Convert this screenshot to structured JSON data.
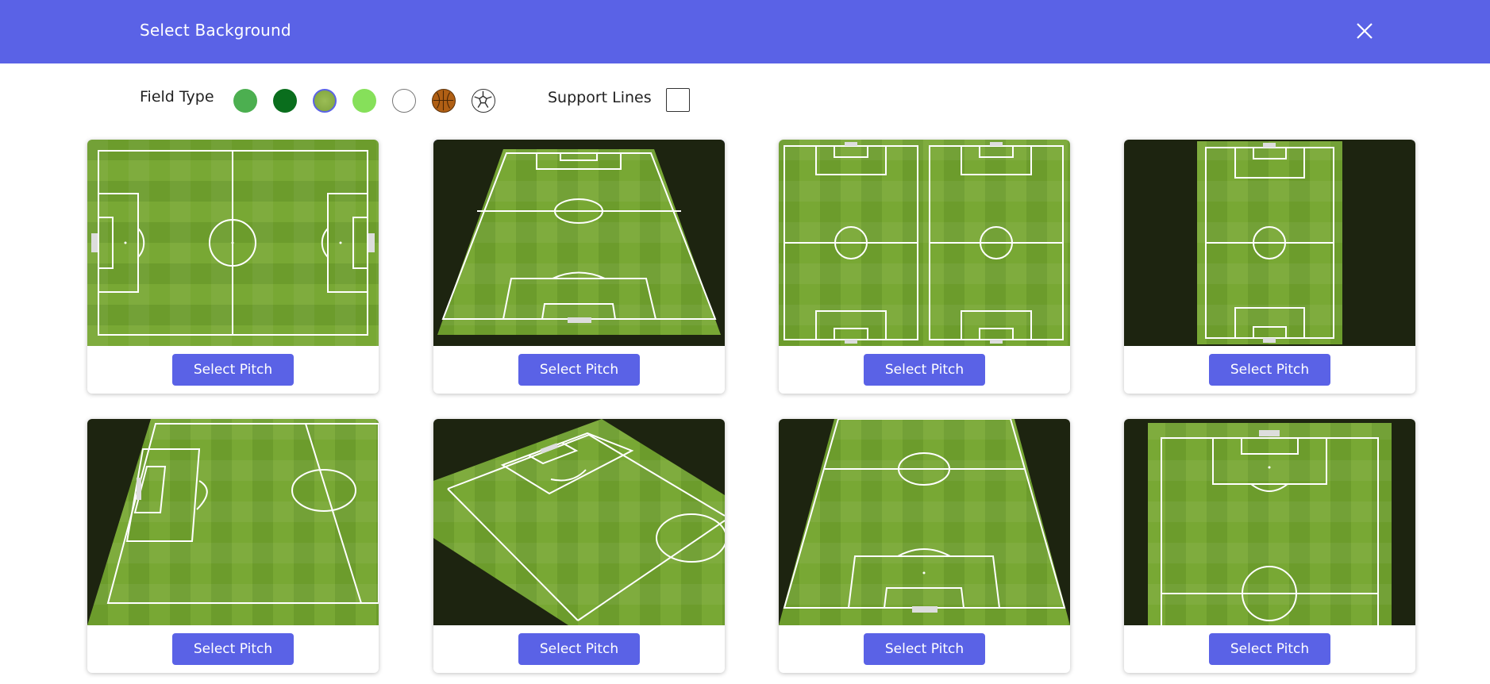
{
  "header": {
    "title": "Select Background",
    "close_icon": "close-icon"
  },
  "toolbar": {
    "field_type_label": "Field Type",
    "field_types": [
      {
        "name": "grass-green",
        "color": "#4caf50"
      },
      {
        "name": "dark-green",
        "color": "#0a6e1d"
      },
      {
        "name": "textured-grass",
        "color": "#8db04a",
        "selected": true
      },
      {
        "name": "light-green",
        "color": "#86e05a"
      },
      {
        "name": "white",
        "color": "#ffffff"
      },
      {
        "name": "basketball-court",
        "color": "#b05f14"
      },
      {
        "name": "soccer-ball",
        "color": "#ffffff"
      }
    ],
    "support_lines_label": "Support Lines",
    "support_lines_checked": false
  },
  "pitches": [
    {
      "view": "full-horizontal",
      "button": "Select Pitch",
      "selected": false
    },
    {
      "view": "perspective-full",
      "button": "Select Pitch",
      "selected": true
    },
    {
      "view": "two-vertical",
      "button": "Select Pitch",
      "selected": false
    },
    {
      "view": "full-vertical",
      "button": "Select Pitch",
      "selected": false
    },
    {
      "view": "perspective-half-side",
      "button": "Select Pitch",
      "selected": false
    },
    {
      "view": "perspective-diagonal",
      "button": "Select Pitch",
      "selected": false
    },
    {
      "view": "perspective-half-bottom",
      "button": "Select Pitch",
      "selected": false
    },
    {
      "view": "half-vertical-top",
      "button": "Select Pitch",
      "selected": false
    }
  ],
  "colors": {
    "accent": "#5a62e6",
    "grass_light": "#7fae3a",
    "grass_dark": "#6a9a2c",
    "surround": "#1d2410"
  }
}
